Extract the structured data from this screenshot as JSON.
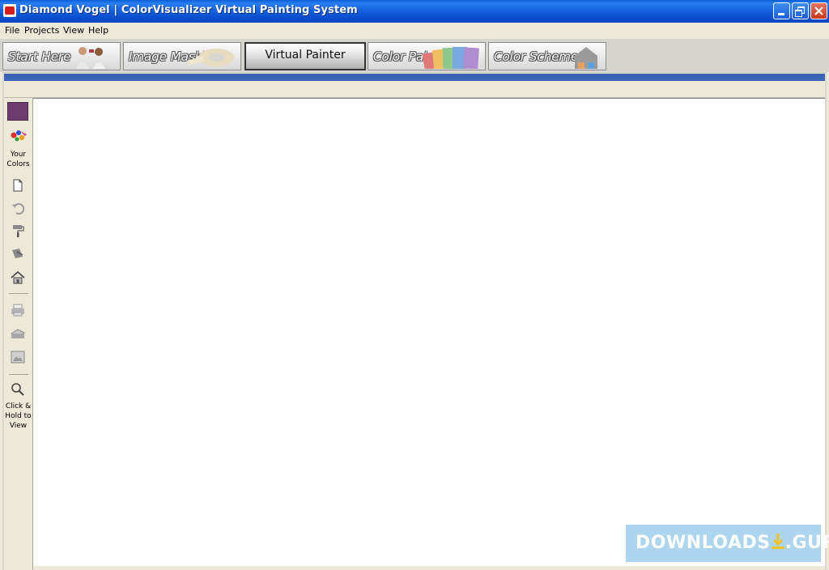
{
  "window": {
    "title": "Diamond Vogel | ColorVisualizer Virtual Painting System",
    "title_bar_color": "#0a5fd9"
  },
  "menu": {
    "items": [
      "File",
      "Projects",
      "View",
      "Help"
    ]
  },
  "tabs": [
    {
      "label": "Start Here",
      "active": false
    },
    {
      "label": "Image Masking",
      "active": false
    },
    {
      "label": "Virtual Painter",
      "active": true
    },
    {
      "label": "Color Palette",
      "active": false
    },
    {
      "label": "Color Schemes",
      "active": false
    }
  ],
  "toolbar": {
    "current_color": "#6e3b6e",
    "your_colors_label_1": "Your",
    "your_colors_label_2": "Colors",
    "click_hold_label_1": "Click &",
    "click_hold_label_2": "Hold to",
    "click_hold_label_3": "View",
    "icons": [
      "paint-splash-icon",
      "new-document-icon",
      "undo-icon",
      "paint-roller-icon",
      "paint-brush-icon",
      "house-icon",
      "print-icon",
      "scan-icon",
      "image-icon",
      "magnifier-icon"
    ]
  },
  "accent_color": "#3b64b8",
  "watermark": {
    "text_1": "DOWNLOADS",
    "text_2": ".GURU"
  }
}
